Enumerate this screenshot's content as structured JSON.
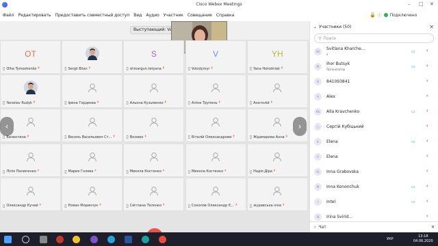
{
  "window": {
    "title": "Cisco Webex Meetings"
  },
  "menu": [
    "Файл",
    "Редактировать",
    "Предоставить совместный доступ",
    "Вид",
    "Аудио",
    "Участник",
    "Совещание",
    "Справка"
  ],
  "status": {
    "connection": "Подключено"
  },
  "stage": {
    "speaker_label": "Выступающий: Val"
  },
  "tiles": [
    {
      "name": "Olha Tymoshenko",
      "initials": "OT",
      "initials_color": "#e36d4a",
      "type": "initials"
    },
    {
      "name": "Sergii Bilan",
      "type": "photo"
    },
    {
      "name": "shmargun.tetyana",
      "initials": "S",
      "initials_color": "#a06ad8",
      "type": "initials"
    },
    {
      "name": "Volodymyr",
      "initials": "V",
      "initials_color": "#6a8fe0",
      "type": "initials"
    },
    {
      "name": "Yana Horodniak",
      "initials": "YH",
      "initials_color": "#b1b83a",
      "type": "initials"
    },
    {
      "name": "Yaroslav Rudyk",
      "type": "photo"
    },
    {
      "name": "Ірина Гордеєва",
      "type": "silhouette"
    },
    {
      "name": "Альона Кузьменко",
      "type": "silhouette"
    },
    {
      "name": "Аліна Трупень",
      "type": "silhouette"
    },
    {
      "name": "Анатолій",
      "type": "silhouette"
    },
    {
      "name": "Валентина",
      "type": "silhouette"
    },
    {
      "name": "Василь Васильович Ст...",
      "type": "silhouette"
    },
    {
      "name": "Вознюк",
      "type": "silhouette"
    },
    {
      "name": "Віталій Олександрови",
      "type": "silhouette"
    },
    {
      "name": "Ждамарова Анна",
      "type": "silhouette"
    },
    {
      "name": "Лілія Пилипенко",
      "type": "silhouette"
    },
    {
      "name": "Мария Голева",
      "type": "silhouette"
    },
    {
      "name": "Микола Костенко",
      "type": "silhouette"
    },
    {
      "name": "Микола Костенко",
      "type": "silhouette"
    },
    {
      "name": "Надія Діра",
      "type": "silhouette"
    },
    {
      "name": "Олександр Кучай",
      "type": "silhouette"
    },
    {
      "name": "Роман Моринчук",
      "type": "silhouette"
    },
    {
      "name": "Світлана Телєнко",
      "type": "silhouette"
    },
    {
      "name": "Соколов Олександр Є...",
      "type": "silhouette"
    },
    {
      "name": "журавська ніна",
      "type": "silhouette"
    }
  ],
  "panel": {
    "title": "Участники (50)",
    "search_placeholder": "Поиск",
    "participants": [
      {
        "initials": "SK",
        "name": "Svitlana Kharche...",
        "sub": "я",
        "cam": true
      },
      {
        "initials": "IB",
        "name": "Ihor Butsyk",
        "sub": "Организатор",
        "cam": true
      },
      {
        "initials": "8",
        "name": "841093841",
        "cam": false
      },
      {
        "initials": "A",
        "name": "Alex",
        "cam": false
      },
      {
        "initials": "AK",
        "name": "Alla Kravchenko",
        "cam": true
      },
      {
        "initials": "",
        "name": "Сергій Кубіцький",
        "cam": false
      },
      {
        "initials": "E",
        "name": "Elena",
        "cam": true
      },
      {
        "initials": "E",
        "name": "Elena",
        "cam": false
      },
      {
        "initials": "IG",
        "name": "Inna Grabovska",
        "cam": false
      },
      {
        "initials": "IK",
        "name": "Inna Kononchuk",
        "cam": true
      },
      {
        "initials": "I",
        "name": "Intel",
        "cam": true
      },
      {
        "initials": "IS",
        "name": "Irina Svirid...",
        "cam": false
      }
    ],
    "chat_label": "Чат"
  },
  "taskbar": {
    "time": "13:18",
    "date": "04.06.2020",
    "lang": "УКР"
  }
}
